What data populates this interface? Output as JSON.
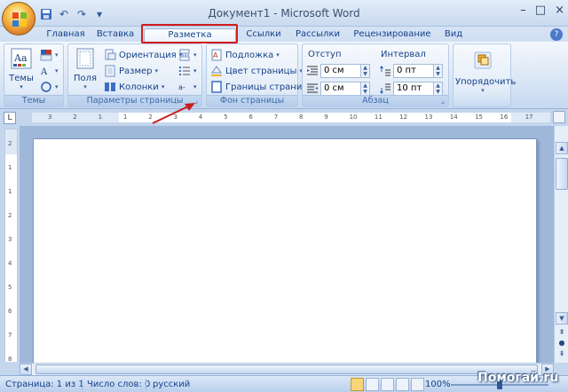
{
  "window": {
    "title": "Документ1 - Microsoft Word",
    "controls": [
      "–",
      "□",
      "×"
    ]
  },
  "quick_access": [
    "save-icon",
    "undo-icon",
    "redo-icon",
    "customize-icon"
  ],
  "tabs": [
    {
      "label": "Главная"
    },
    {
      "label": "Вставка"
    },
    {
      "label": "Разметка страницы"
    },
    {
      "label": "Ссылки"
    },
    {
      "label": "Рассылки"
    },
    {
      "label": "Рецензирование"
    },
    {
      "label": "Вид"
    }
  ],
  "active_tab": "Разметка страницы",
  "ribbon": {
    "themes": {
      "label": "Темы",
      "button": "Темы"
    },
    "page_setup": {
      "label": "Параметры страницы",
      "margins": "Поля",
      "orientation": "Ориентация",
      "size": "Размер",
      "columns": "Колонки"
    },
    "page_background": {
      "label": "Фон страницы",
      "watermark": "Подложка",
      "page_color": "Цвет страницы",
      "page_borders": "Границы страниц"
    },
    "paragraph": {
      "label": "Абзац",
      "indent_title": "Отступ",
      "spacing_title": "Интервал",
      "indent_left": "0 см",
      "indent_right": "0 см",
      "spacing_before": "0 пт",
      "spacing_after": "10 пт"
    },
    "arrange": {
      "label": "Упорядочить"
    }
  },
  "ruler": {
    "h_numbers": [
      "3",
      "2",
      "1",
      "1",
      "2",
      "3",
      "4",
      "5",
      "6",
      "7",
      "8",
      "9",
      "10",
      "11",
      "12",
      "13",
      "14",
      "15",
      "16",
      "17"
    ],
    "v_numbers": [
      "2",
      "1",
      "1",
      "2",
      "3",
      "4",
      "5",
      "6",
      "7",
      "8"
    ]
  },
  "status": {
    "page": "Страница: 1 из 1",
    "words": "Число слов: 0",
    "language": "русский",
    "zoom": "100%"
  },
  "watermark_text": "Помогай.ru",
  "colors": {
    "accent": "#15428b",
    "highlight_box": "#d41c1c",
    "annotation_arrow": "#c81e1e"
  }
}
